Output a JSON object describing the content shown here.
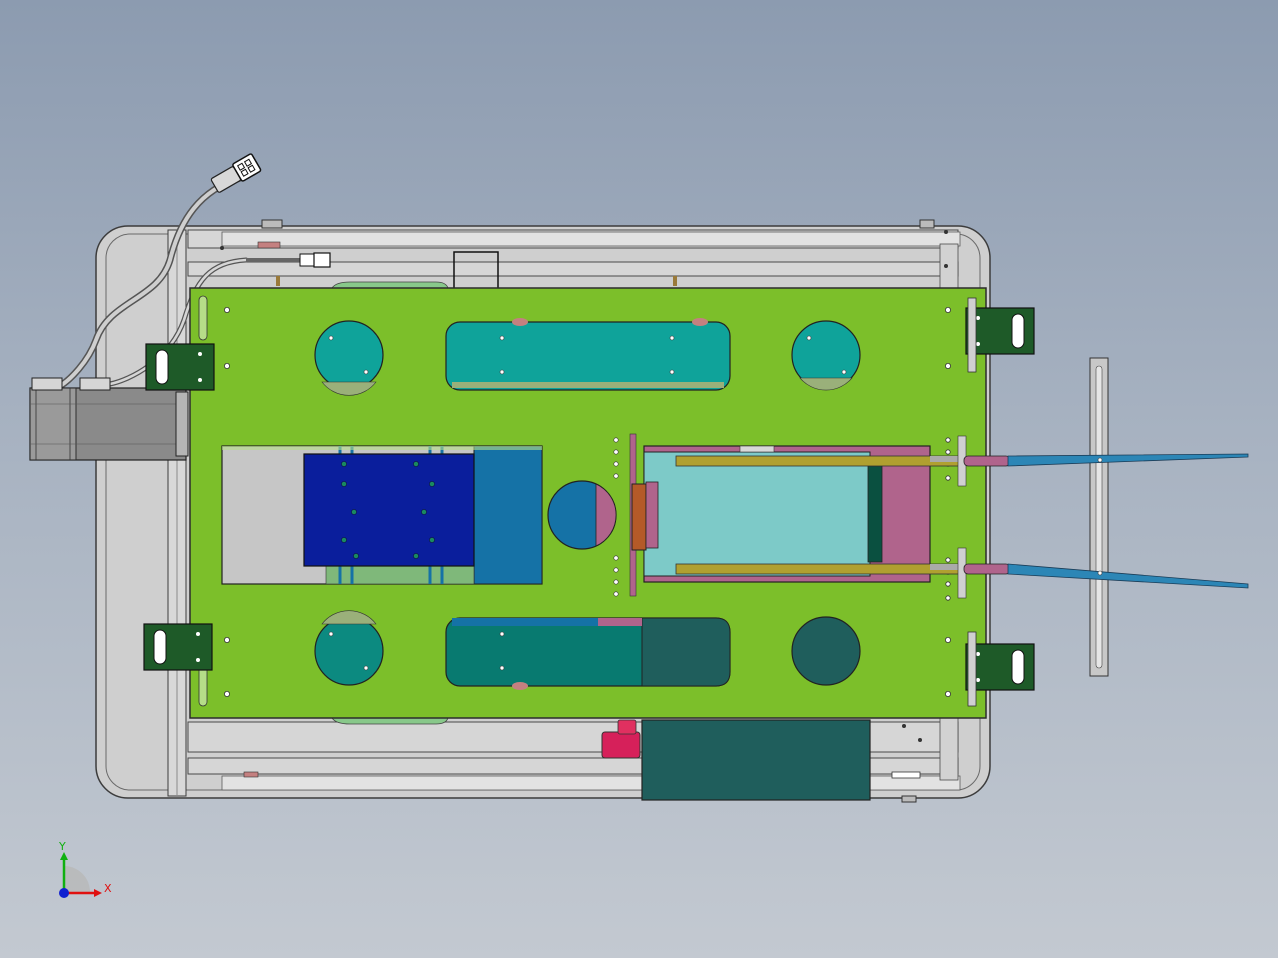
{
  "viewport": {
    "background_top": "#8c9bb0",
    "background_bottom": "#c3c9d1"
  },
  "model": {
    "colors": {
      "frame": "#c8c8c8",
      "frame_edge": "#3c3c3c",
      "base_plate": "#7cbf2a",
      "teal": "#0fa39a",
      "dark_teal": "#087a70",
      "slate_teal": "#1f5e5c",
      "navy": "#0a1e9c",
      "steel_blue": "#1572a6",
      "light_cyan": "#7dcac8",
      "pink": "#b0648c",
      "olive": "#b0a030",
      "rust": "#b45a28",
      "bracket": "#1e5a28",
      "red": "#d6205a",
      "arm": "#2c86b6"
    }
  },
  "triad": {
    "x_label": "X",
    "y_label": "Y",
    "x_color": "#e01010",
    "y_color": "#10b010",
    "z_color": "#1020d0"
  }
}
